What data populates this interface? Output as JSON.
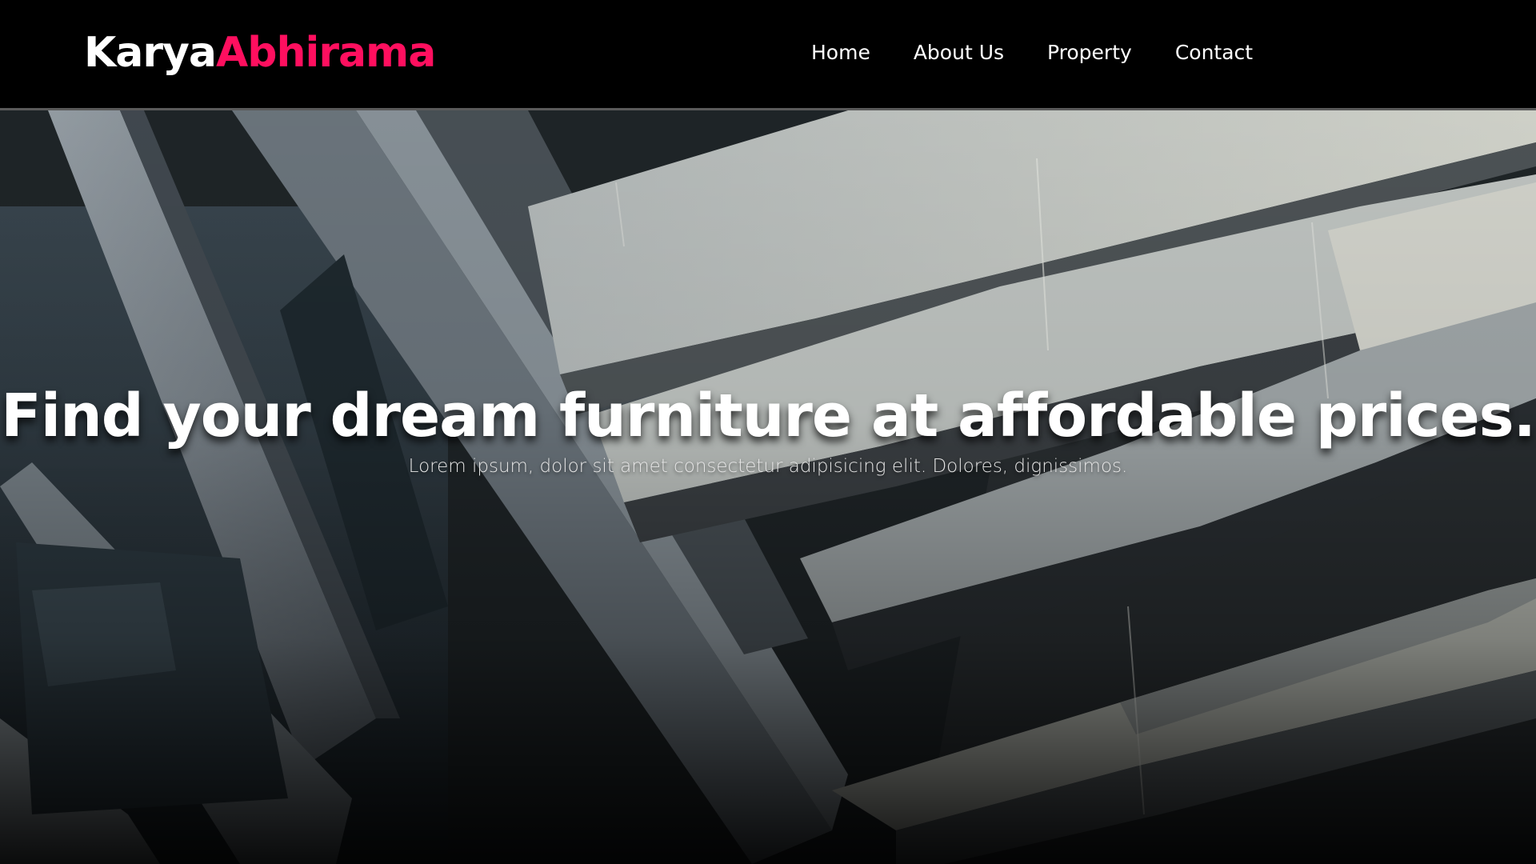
{
  "brand": {
    "part1": "Karya",
    "part2": "Abhirama",
    "accent_color": "#ff0f5f"
  },
  "nav": {
    "items": [
      {
        "label": "Home"
      },
      {
        "label": "About Us"
      },
      {
        "label": "Property"
      },
      {
        "label": "Contact"
      }
    ]
  },
  "hero": {
    "headline": "Find your dream furniture at affordable prices.",
    "subtext": "Lorem ipsum, dolor sit amet consectetur adipisicing elit. Dolores, dignissimos."
  }
}
